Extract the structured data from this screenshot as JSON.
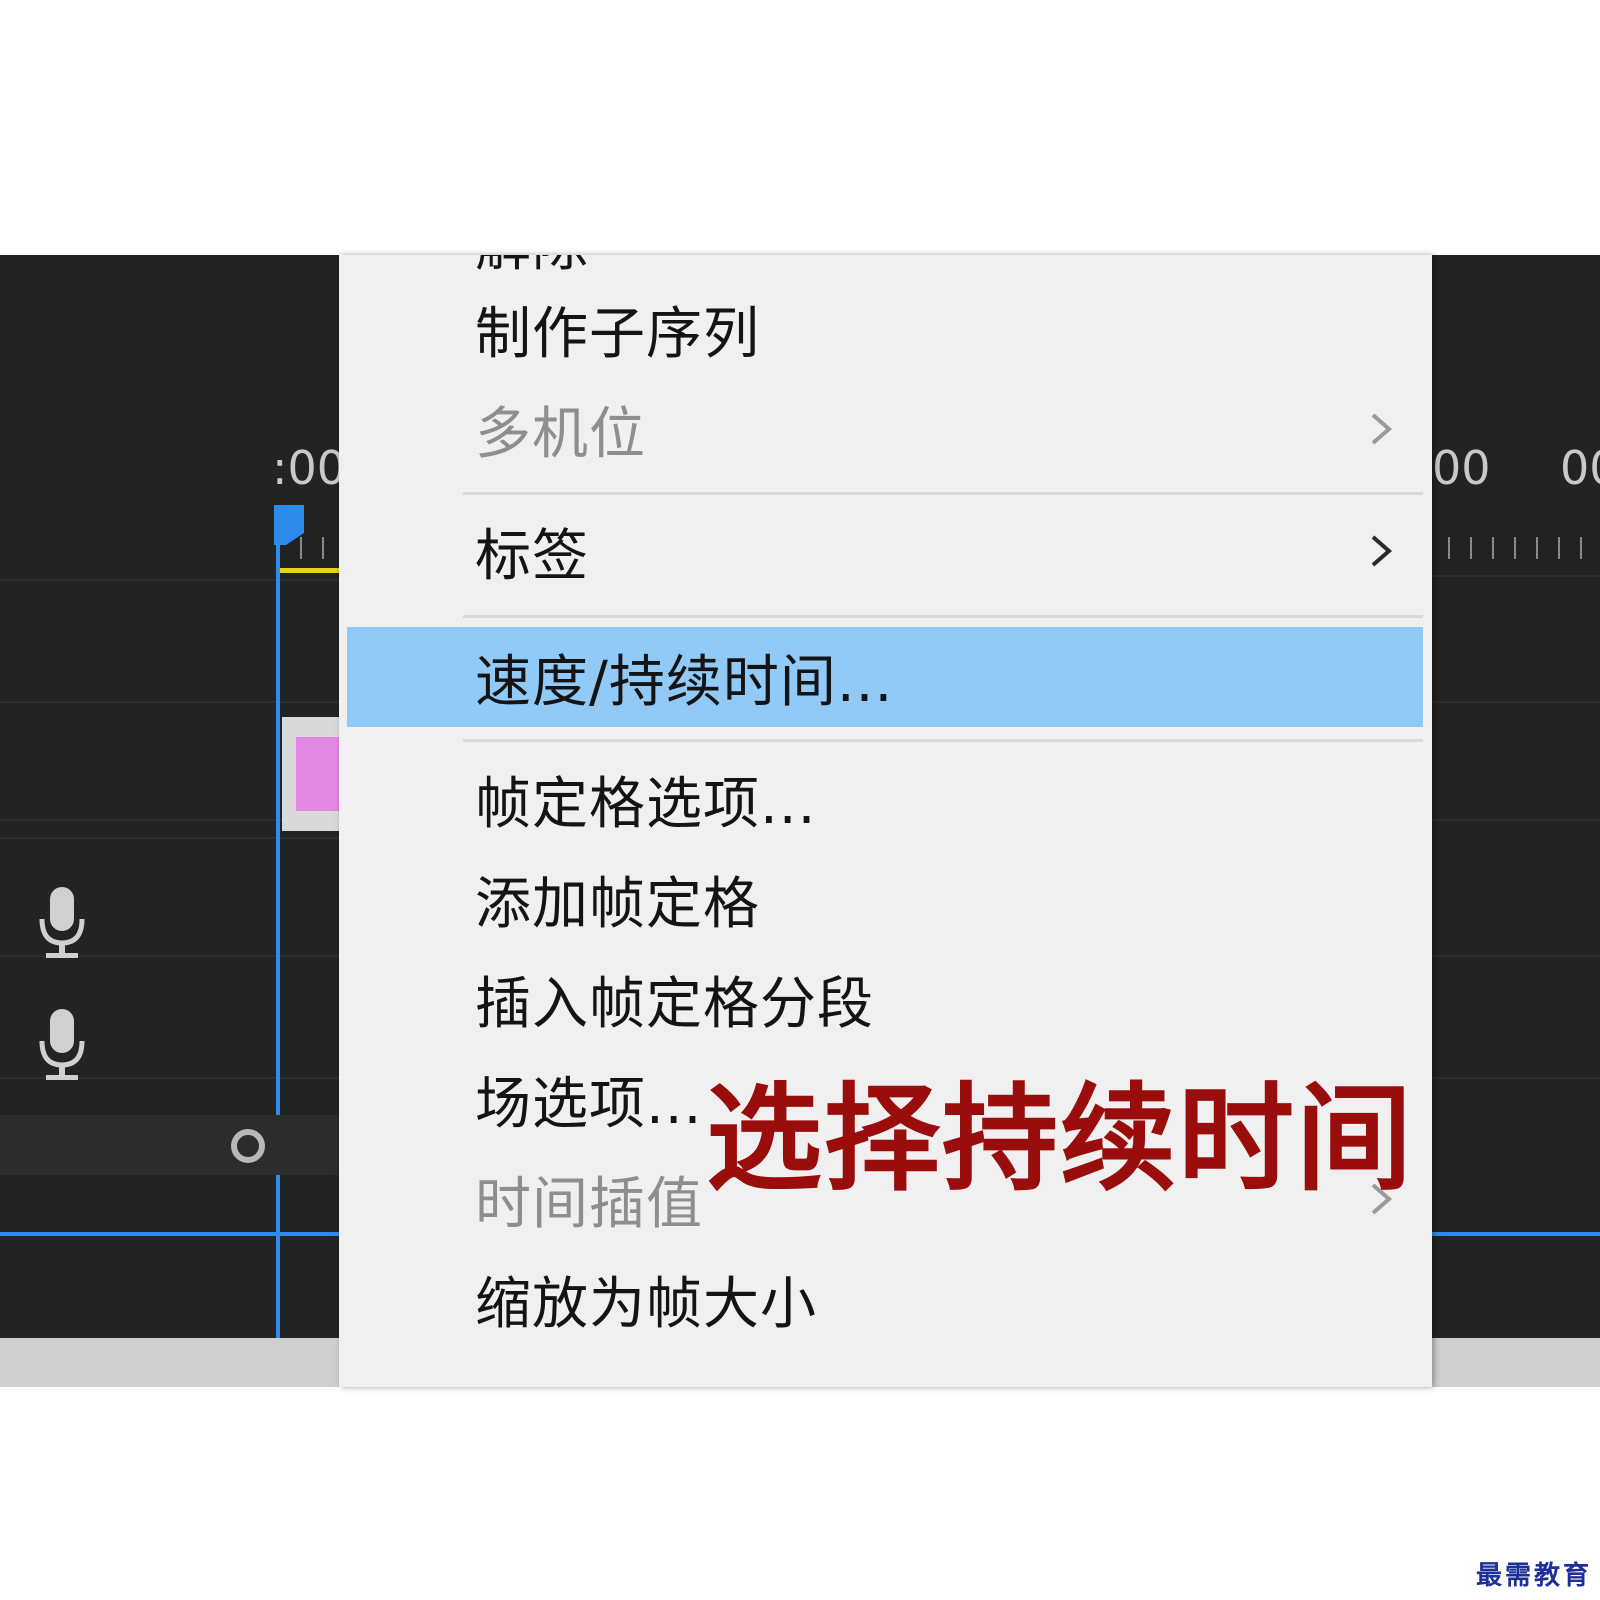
{
  "timeline": {
    "timecode_left": ":00",
    "timecode_right_1": "00",
    "timecode_right_2": "00",
    "accent_color": "#2d8ceb",
    "clip_color": "#e288e3",
    "icons": [
      "microphone-icon",
      "microphone-icon",
      "zoom-handle-icon"
    ]
  },
  "context_menu": {
    "partial_top_label": "解除",
    "items": [
      {
        "label": "制作子序列",
        "enabled": true,
        "submenu": false
      },
      {
        "label": "多机位",
        "enabled": false,
        "submenu": true
      },
      {
        "label": "标签",
        "enabled": true,
        "submenu": true
      },
      {
        "label": "速度/持续时间...",
        "enabled": true,
        "submenu": false,
        "highlighted": true
      },
      {
        "label": "帧定格选项...",
        "enabled": true,
        "submenu": false
      },
      {
        "label": "添加帧定格",
        "enabled": true,
        "submenu": false
      },
      {
        "label": "插入帧定格分段",
        "enabled": true,
        "submenu": false
      },
      {
        "label": "场选项...",
        "enabled": true,
        "submenu": false
      },
      {
        "label": "时间插值",
        "enabled": false,
        "submenu": true
      },
      {
        "label": "缩放为帧大小",
        "enabled": true,
        "submenu": false
      }
    ],
    "highlight_color": "#91c9f7"
  },
  "annotation": {
    "text": "选择持续时间",
    "color": "#9a0d0d"
  },
  "watermark": {
    "text": "最需教育",
    "color": "#1e2f9a"
  }
}
